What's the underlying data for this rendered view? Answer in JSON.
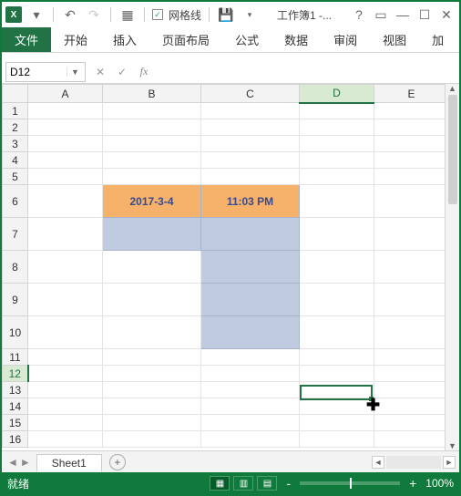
{
  "titlebar": {
    "gridlines_label": "网格线",
    "doc_title": "工作簿1 -..."
  },
  "ribbon": {
    "file": "文件",
    "tabs": [
      "开始",
      "插入",
      "页面布局",
      "公式",
      "数据",
      "审阅",
      "视图",
      "加"
    ]
  },
  "fxbar": {
    "namebox_value": "D12",
    "fx_label": "fx"
  },
  "grid": {
    "columns": [
      "A",
      "B",
      "C",
      "D",
      "E"
    ],
    "rows": [
      "1",
      "2",
      "3",
      "4",
      "5",
      "6",
      "7",
      "8",
      "9",
      "10",
      "11",
      "12",
      "13",
      "14",
      "15",
      "16"
    ],
    "active_col": "D",
    "active_row": "12",
    "cells": {
      "B6": "2017-3-4",
      "C6": "11:03 PM"
    }
  },
  "sheet_tabs": {
    "active": "Sheet1"
  },
  "status": {
    "ready": "就绪",
    "zoom": "100%"
  }
}
